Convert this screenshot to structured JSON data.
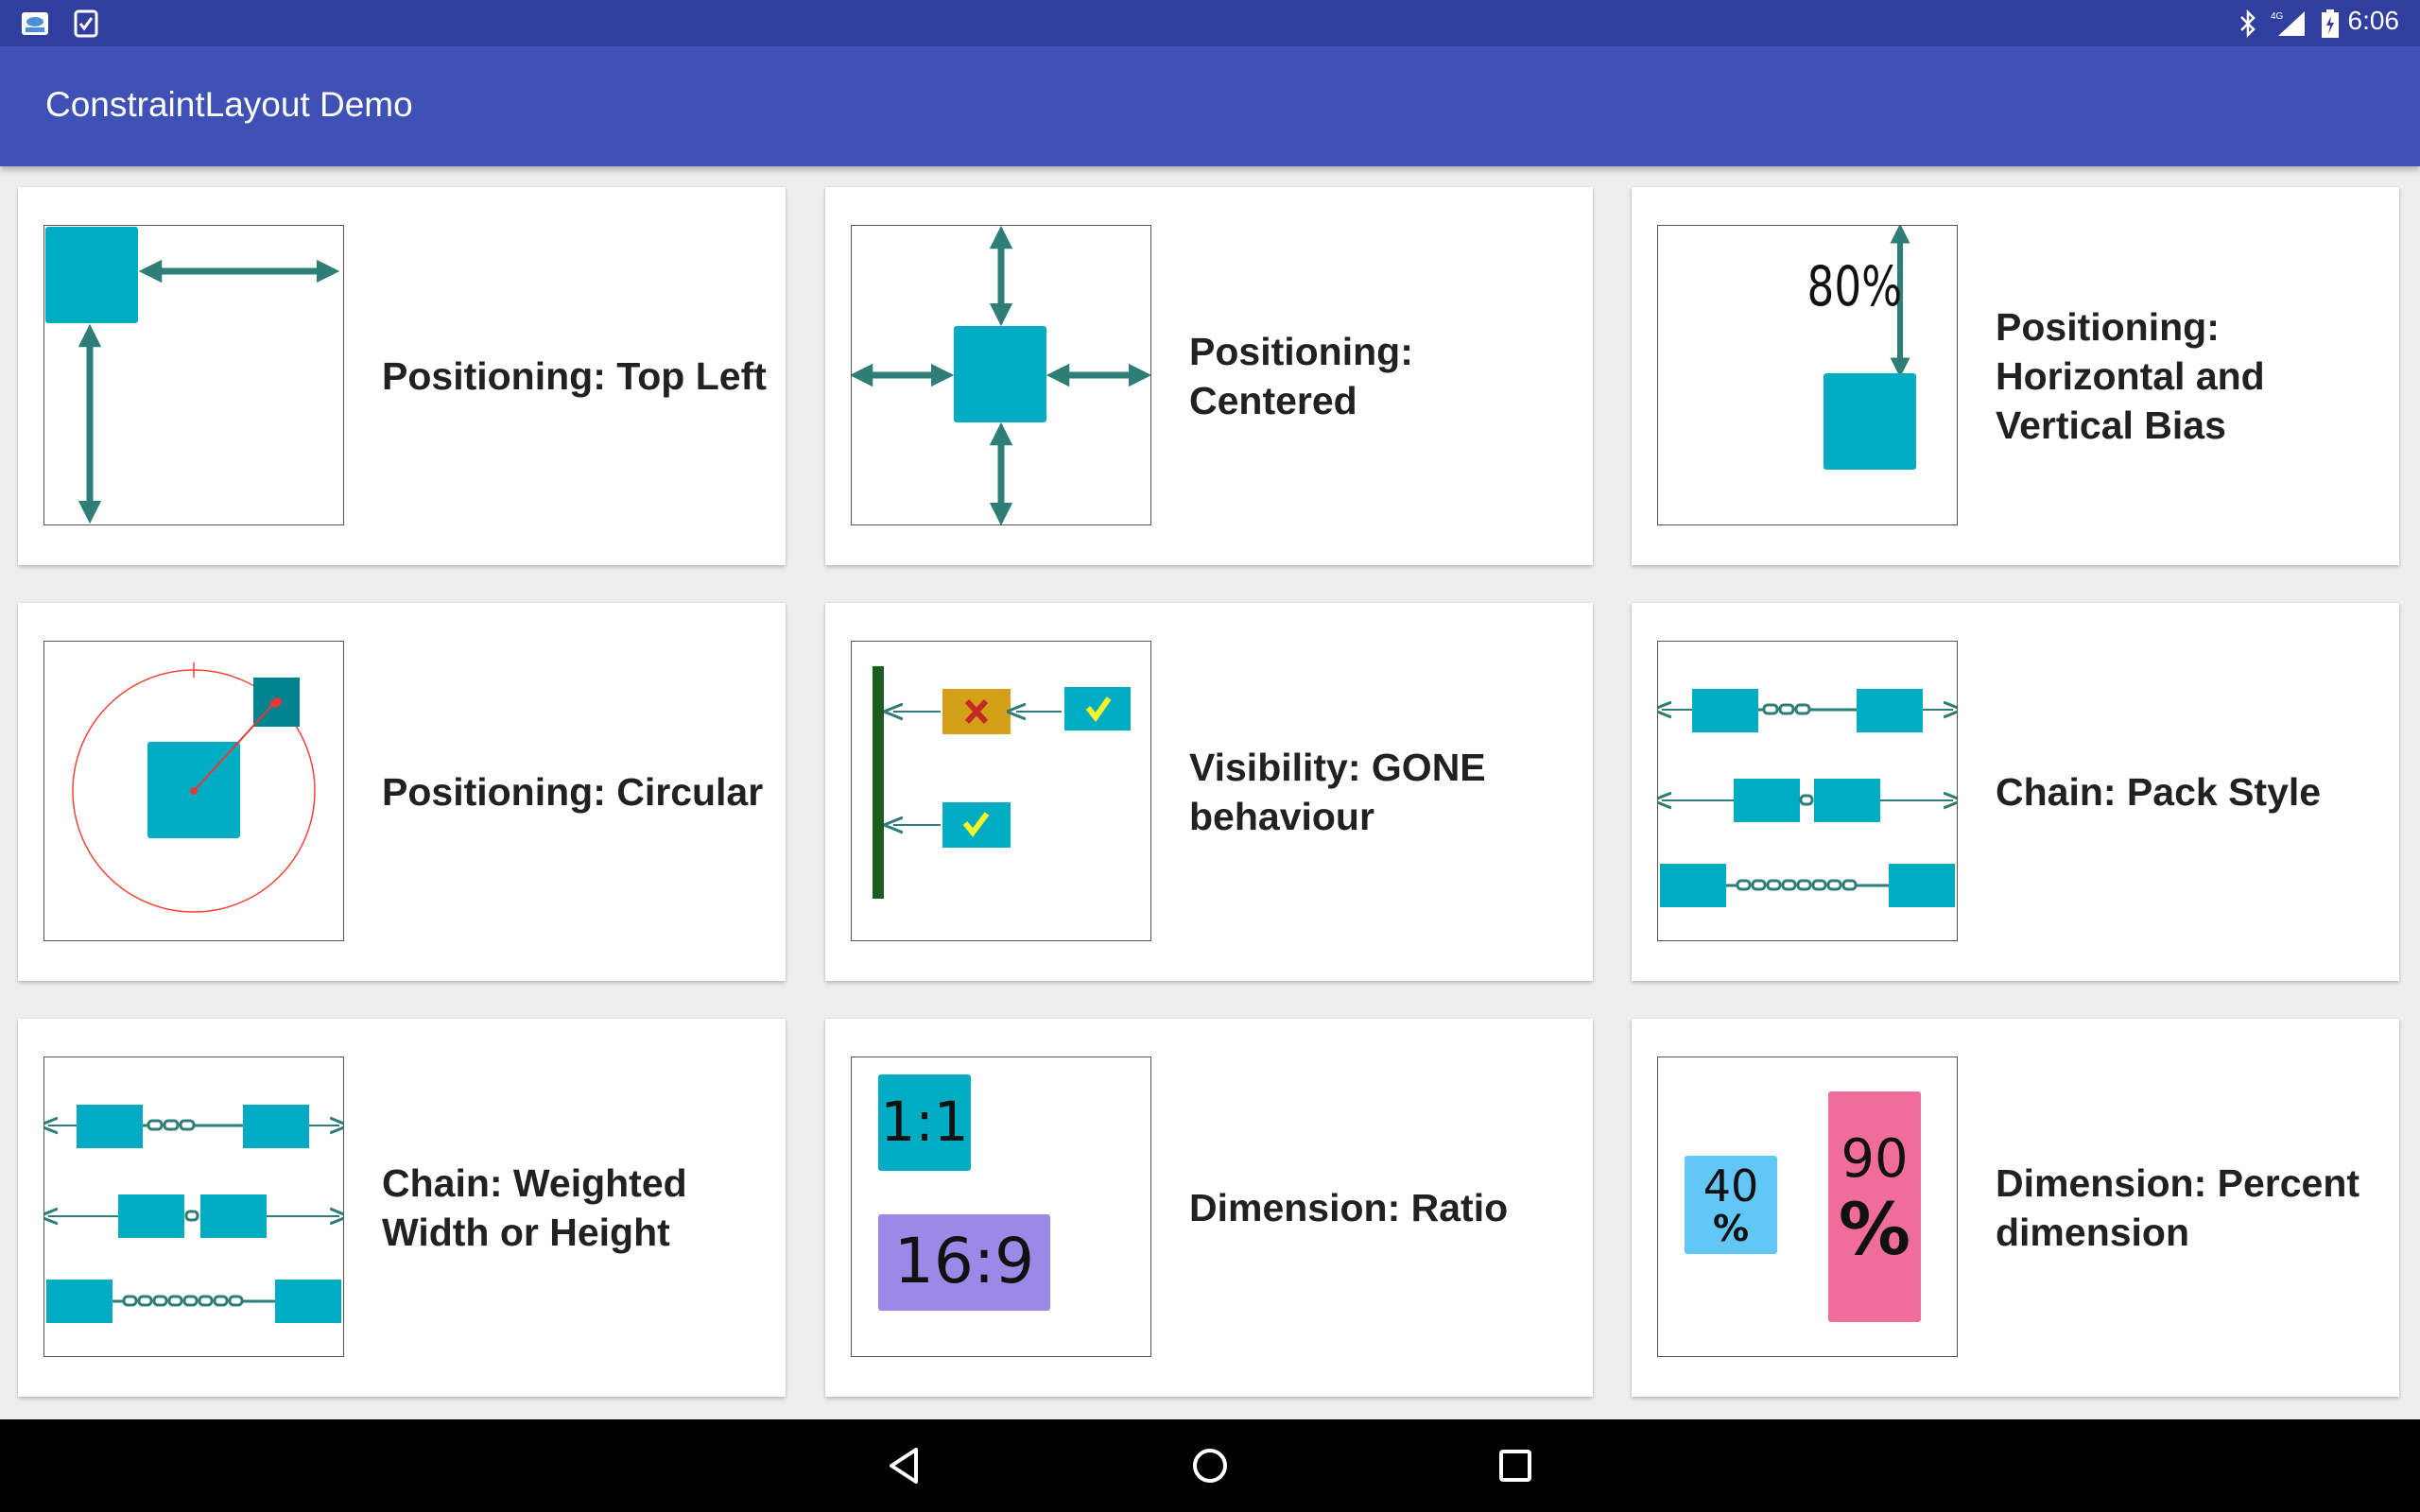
{
  "status_bar": {
    "time": "6:06",
    "network": "4G",
    "icons": [
      "weather-app-icon",
      "task-check-icon",
      "bluetooth-icon",
      "signal-icon",
      "battery-charging-icon"
    ]
  },
  "app_bar": {
    "title": "ConstraintLayout Demo"
  },
  "cards": [
    {
      "label": "Positioning: Top Left"
    },
    {
      "label": "Positioning: Centered"
    },
    {
      "label": "Positioning: Horizontal and Vertical Bias"
    },
    {
      "label": "Positioning: Circular"
    },
    {
      "label": "Visibility: GONE behaviour"
    },
    {
      "label": "Chain: Pack Style"
    },
    {
      "label": "Chain: Weighted Width or Height"
    },
    {
      "label": "Dimension: Ratio"
    },
    {
      "label": "Dimension: Percent dimension"
    }
  ],
  "thumb_text": {
    "bias_percent": "80%",
    "ratio_square": "1:1",
    "ratio_wide": "16:9",
    "percent_small_num": "40",
    "percent_small_sign": "%",
    "percent_large_num": "90",
    "percent_large_sign": "%"
  },
  "nav_bar": {
    "buttons": [
      "back-icon",
      "home-icon",
      "recents-icon"
    ]
  },
  "colors": {
    "status_bar": "#303f9f",
    "app_bar": "#3f51b5",
    "accent_cyan": "#00acc1",
    "arrow_teal": "#2e7d77",
    "circle_red": "#f44336",
    "gone_bar": "#1b5e20",
    "gone_box": "#d4a017",
    "ratio_purple": "#9c88e6",
    "percent_blue": "#63c7f5",
    "percent_pink": "#f06d9b"
  }
}
